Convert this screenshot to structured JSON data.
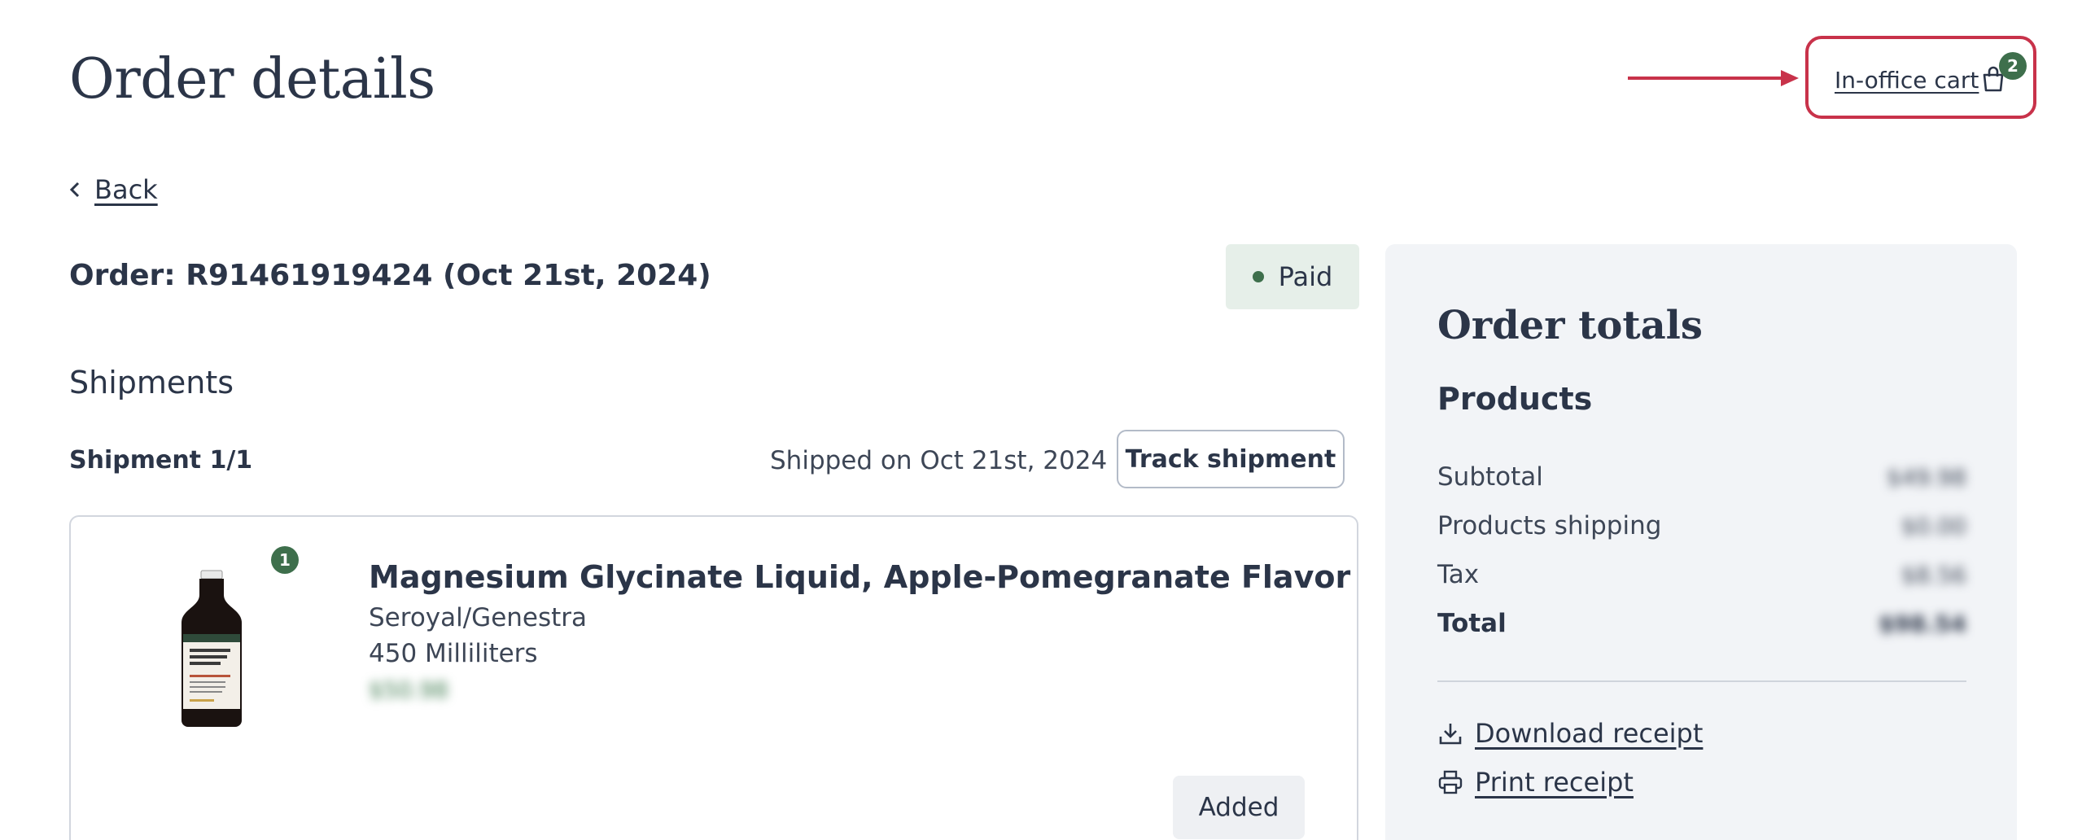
{
  "header": {
    "title": "Order details",
    "cart_label": "In-office cart",
    "cart_count": "2"
  },
  "nav": {
    "back_label": "Back"
  },
  "order": {
    "title": "Order: R91461919424 (Oct 21st, 2024)",
    "status": "Paid",
    "status_color": "#3e6f4c"
  },
  "shipments": {
    "heading": "Shipments",
    "shipment_label": "Shipment 1/1",
    "shipped_on": "Shipped on Oct 21st, 2024",
    "track_label": "Track shipment",
    "items": [
      {
        "quantity": "1",
        "name": "Magnesium Glycinate Liquid, Apple-Pomegranate Flavor",
        "brand": "Seroyal/Genestra",
        "size": "450 Milliliters",
        "price": "$50.98",
        "action_label": "Added"
      }
    ]
  },
  "totals": {
    "title": "Order totals",
    "products_heading": "Products",
    "rows": [
      {
        "label": "Subtotal",
        "value": "$49.98"
      },
      {
        "label": "Products shipping",
        "value": "$0.00"
      },
      {
        "label": "Tax",
        "value": "$8.56"
      },
      {
        "label": "Total",
        "value": "$98.54"
      }
    ],
    "download_label": "Download receipt",
    "print_label": "Print receipt"
  },
  "colors": {
    "brand_green": "#3e6f4c",
    "annotation_red": "#c8324a",
    "text": "#2b3548"
  }
}
